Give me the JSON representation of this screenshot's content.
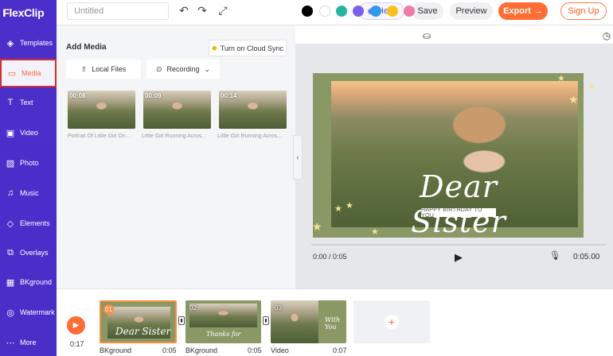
{
  "app": {
    "logo_text": "FlexClip"
  },
  "topbar": {
    "title_placeholder": "Untitled",
    "help_label": "Help",
    "save_label": "Save",
    "preview_label": "Preview",
    "export_label": "Export",
    "signup_label": "Sign Up"
  },
  "sidebar": {
    "items": [
      {
        "label": "Templates",
        "icon": "layers-icon"
      },
      {
        "label": "Media",
        "icon": "folder-icon",
        "active": true
      },
      {
        "label": "Text",
        "icon": "text-icon"
      },
      {
        "label": "Video",
        "icon": "video-icon"
      },
      {
        "label": "Photo",
        "icon": "photo-icon"
      },
      {
        "label": "Music",
        "icon": "music-icon"
      },
      {
        "label": "Elements",
        "icon": "elements-icon"
      },
      {
        "label": "Overlays",
        "icon": "overlays-icon"
      },
      {
        "label": "BKground",
        "icon": "background-icon"
      },
      {
        "label": "Watermark",
        "icon": "watermark-icon"
      },
      {
        "label": "More",
        "icon": "more-icon"
      }
    ]
  },
  "media_panel": {
    "title": "Add Media",
    "cloud_sync_label": "Turn on Cloud Sync",
    "local_files_label": "Local Files",
    "recording_label": "Recording",
    "items": [
      {
        "duration": "00:08",
        "caption": "Portrait Of Little Girl On ..."
      },
      {
        "duration": "00:09",
        "caption": "Little Girl Running Acros..."
      },
      {
        "duration": "00:14",
        "caption": "Little Girl Running Acros..."
      }
    ]
  },
  "colors": {
    "swatches": [
      "#000000",
      "#ffffff",
      "#26b5a0",
      "#7b61e8",
      "#2e9bf0",
      "#f7c21a",
      "#f07aa8"
    ],
    "accent": "#ff6d34",
    "sidebar": "#4b2fcb"
  },
  "preview": {
    "title_text": "Dear Sister",
    "subtitle_text": "HAPPY BIRTHDAY TO YOU",
    "current_time": "0:00 / 0:05",
    "total_time": "0:05.00"
  },
  "timeline": {
    "current_time": "0:17",
    "scenes": [
      {
        "number": "01",
        "label": "BKground",
        "duration": "0:05",
        "overlay_text": "Dear Sister"
      },
      {
        "number": "02",
        "label": "BKground",
        "duration": "0:05",
        "overlay_text": "Thanks for"
      },
      {
        "number": "03",
        "label": "Video",
        "duration": "0:07",
        "overlay_text": "With You"
      }
    ]
  }
}
